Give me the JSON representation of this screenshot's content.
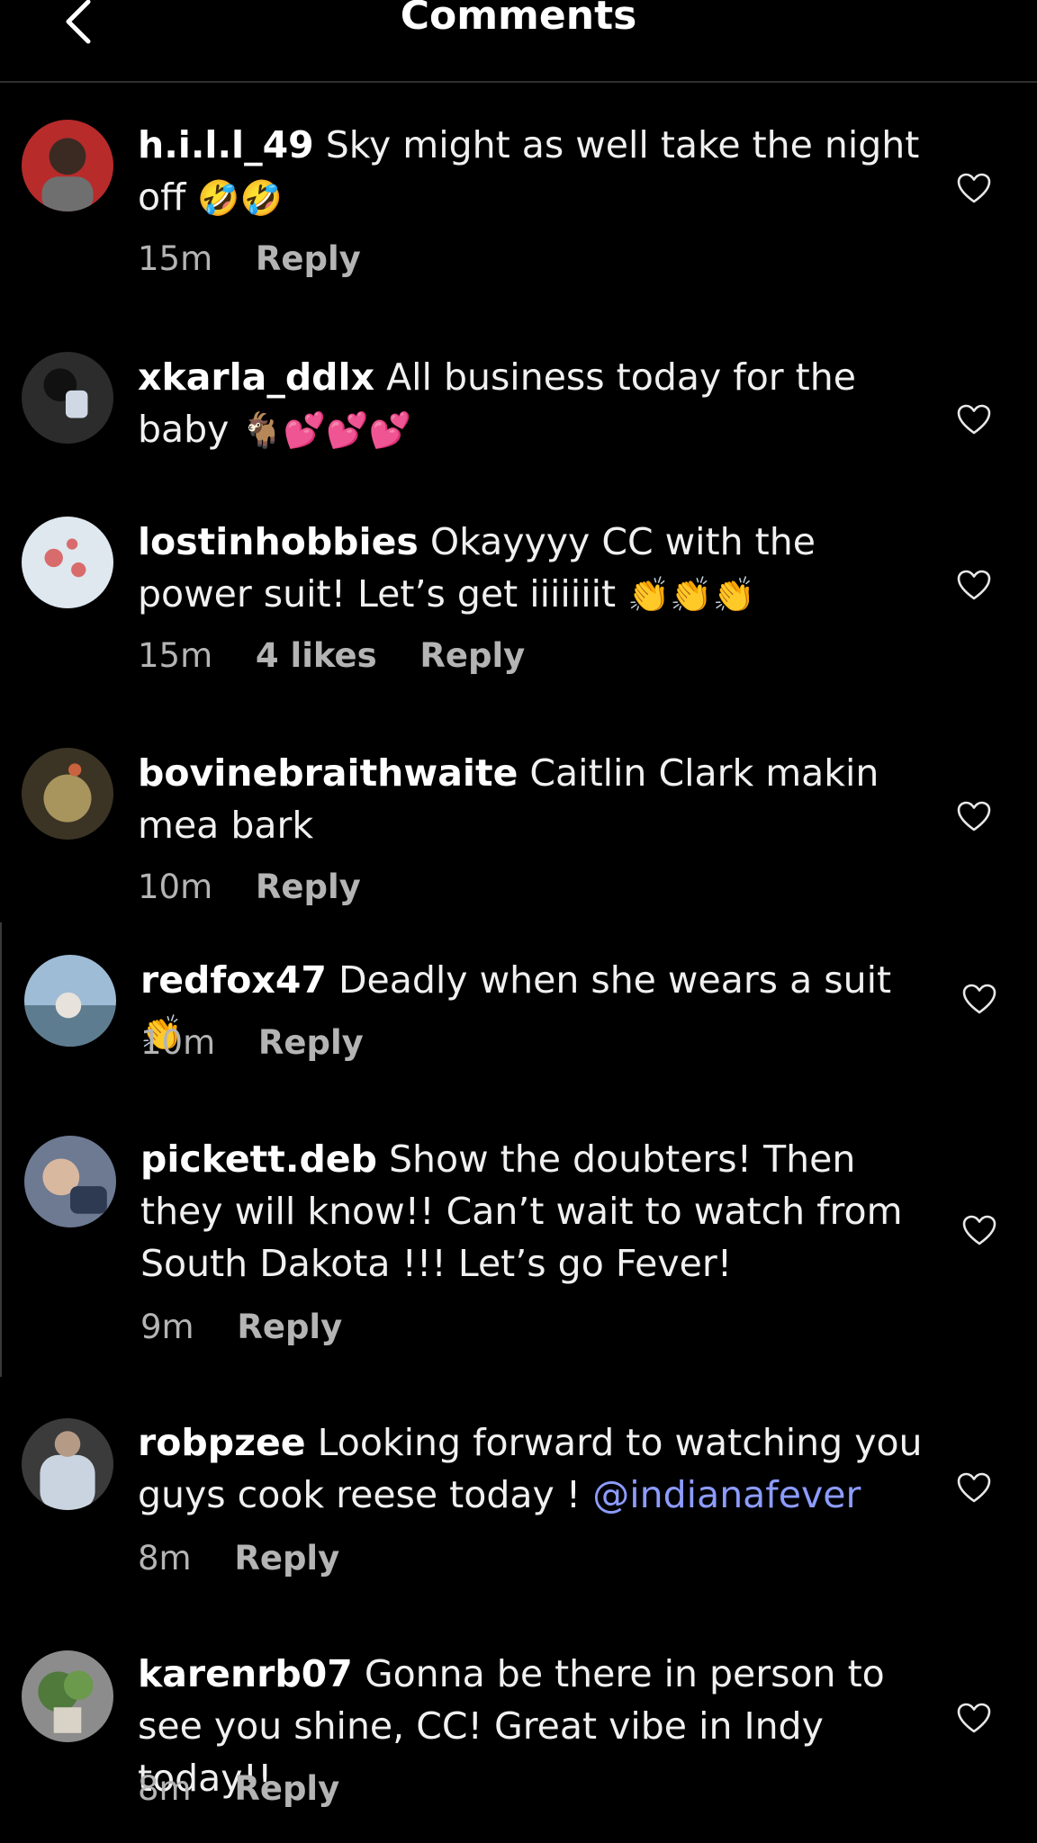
{
  "header": {
    "title": "Comments"
  },
  "comments": [
    {
      "username": "h.i.l.l_49",
      "text": "Sky might as well take the night off",
      "emoji": "🤣🤣",
      "time": "15m",
      "reply": "Reply",
      "avatar_color": "#7a2a2a"
    },
    {
      "username": "xkarla_ddlx",
      "text": "All business today for the baby",
      "emoji": "🐐💕💕💕",
      "time": "",
      "reply": "",
      "avatar_color": "#3d3d3d"
    },
    {
      "username": "lostinhobbies",
      "text": "Okayyyy CC with the power suit! Let’s get iiiiiiit",
      "emoji": "👏👏👏",
      "time": "15m",
      "likes": "4 likes",
      "reply": "Reply",
      "avatar_color": "#c9d6e3"
    },
    {
      "username": "bovinebraithwaite",
      "text": "Caitlin Clark makin mea bark",
      "emoji": "",
      "time": "10m",
      "reply": "Reply",
      "avatar_color": "#8a7a52"
    },
    {
      "username": "redfox47",
      "text": "Deadly when she wears a suit",
      "emoji": "👏",
      "time": "10m",
      "reply": "Reply",
      "avatar_color": "#7fa3c4"
    },
    {
      "username": "pickett.deb",
      "text": "Show the doubters! Then they will know!! Can’t wait to watch from South Dakota !!! Let’s go Fever!",
      "emoji": "",
      "time": "9m",
      "reply": "Reply",
      "avatar_color": "#5b6b8a"
    },
    {
      "username": "robpzee",
      "text": "Looking forward to watching you guys cook reese today !",
      "mention": "@indianafever",
      "emoji": "",
      "time": "8m",
      "reply": "Reply",
      "avatar_color": "#b8c2cf"
    },
    {
      "username": "karenrb07",
      "text": "Gonna be there in person to see you shine, CC! Great vibe in Indy today!!",
      "emoji": "",
      "time": "8m",
      "reply": "Reply",
      "avatar_color": "#4f7a3c"
    }
  ]
}
